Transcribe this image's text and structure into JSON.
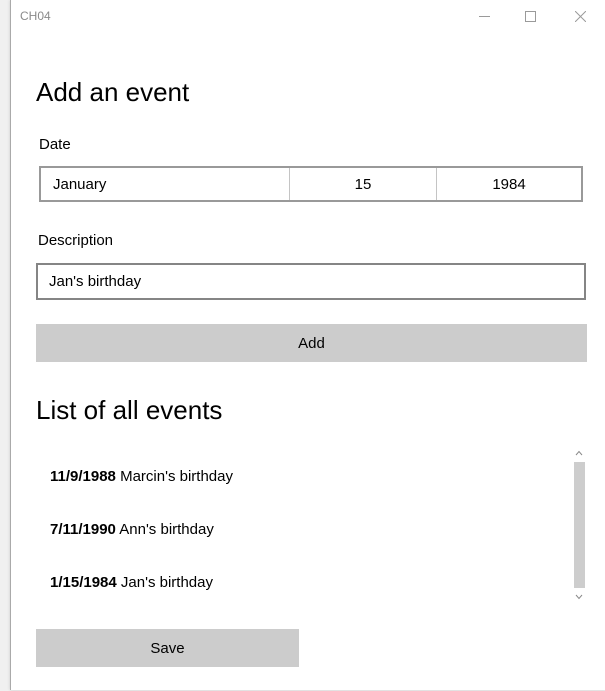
{
  "window": {
    "title": "CH04"
  },
  "titlebar": {
    "minimize_icon": "minimize-icon",
    "maximize_icon": "maximize-icon",
    "close_icon": "close-icon"
  },
  "form": {
    "heading": "Add an event",
    "date_label": "Date",
    "date": {
      "month": "January",
      "day": "15",
      "year": "1984"
    },
    "description_label": "Description",
    "description_value": "Jan's birthday",
    "add_label": "Add"
  },
  "events": {
    "heading": "List of all events",
    "items": [
      {
        "date": "11/9/1988",
        "description": "Marcin's birthday"
      },
      {
        "date": "7/11/1990",
        "description": "Ann's birthday"
      },
      {
        "date": "1/15/1984",
        "description": "Jan's birthday"
      }
    ]
  },
  "save_label": "Save",
  "colors": {
    "button_bg": "#cccccc",
    "window_bg": "#ffffff",
    "title_text": "#8a8a8a"
  }
}
